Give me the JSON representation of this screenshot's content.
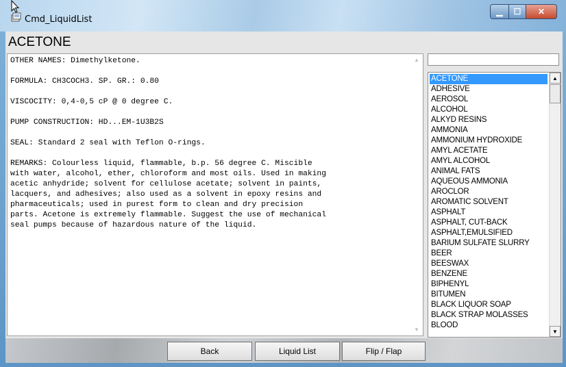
{
  "window": {
    "title": "Cmd_LiquidList",
    "min_symbol": "▁",
    "max_symbol": "☐",
    "close_symbol": "✕"
  },
  "heading": "ACETONE",
  "details": {
    "paragraphs": [
      "OTHER NAMES: Dimethylketone.",
      "FORMULA: CH3COCH3. SP. GR.: 0.80",
      "VISCOCITY: 0,4-0,5 cP @ 0 degree C.",
      "PUMP CONSTRUCTION: HD...EM-1U3B2S",
      "SEAL: Standard 2 seal with Teflon O-rings.",
      "REMARKS: Colourless liquid, flammable, b.p. 56 degree C. Miscible\nwith water, alcohol, ether, chloroform and most oils. Used in making\nacetic anhydride; solvent for cellulose acetate; solvent in paints,\nlacquers, and adhesives; also used as a solvent in epoxy resins and\npharmaceuticals; used in purest form to clean and dry precision\nparts. Acetone is extremely flammable. Suggest the use of mechanical\nseal pumps because of hazardous nature of the liquid."
    ]
  },
  "search": {
    "value": ""
  },
  "liquids": [
    "ACETONE",
    "ADHESIVE",
    "AEROSOL",
    "ALCOHOL",
    "ALKYD RESINS",
    "AMMONIA",
    "AMMONIUM HYDROXIDE",
    "AMYL ACETATE",
    "AMYL ALCOHOL",
    "ANIMAL FATS",
    "AQUEOUS AMMONIA",
    "AROCLOR",
    "AROMATIC SOLVENT",
    "ASPHALT",
    "ASPHALT, CUT-BACK",
    "ASPHALT,EMULSIFIED",
    "BARIUM SULFATE SLURRY",
    "BEER",
    "BEESWAX",
    "BENZENE",
    "BIPHENYL",
    "BITUMEN",
    "BLACK LIQUOR SOAP",
    "BLACK STRAP MOLASSES",
    "BLOOD"
  ],
  "selected_index": 0,
  "buttons": {
    "back": "Back",
    "liquid_list": "Liquid List",
    "flip_flap": "Flip / Flap"
  }
}
